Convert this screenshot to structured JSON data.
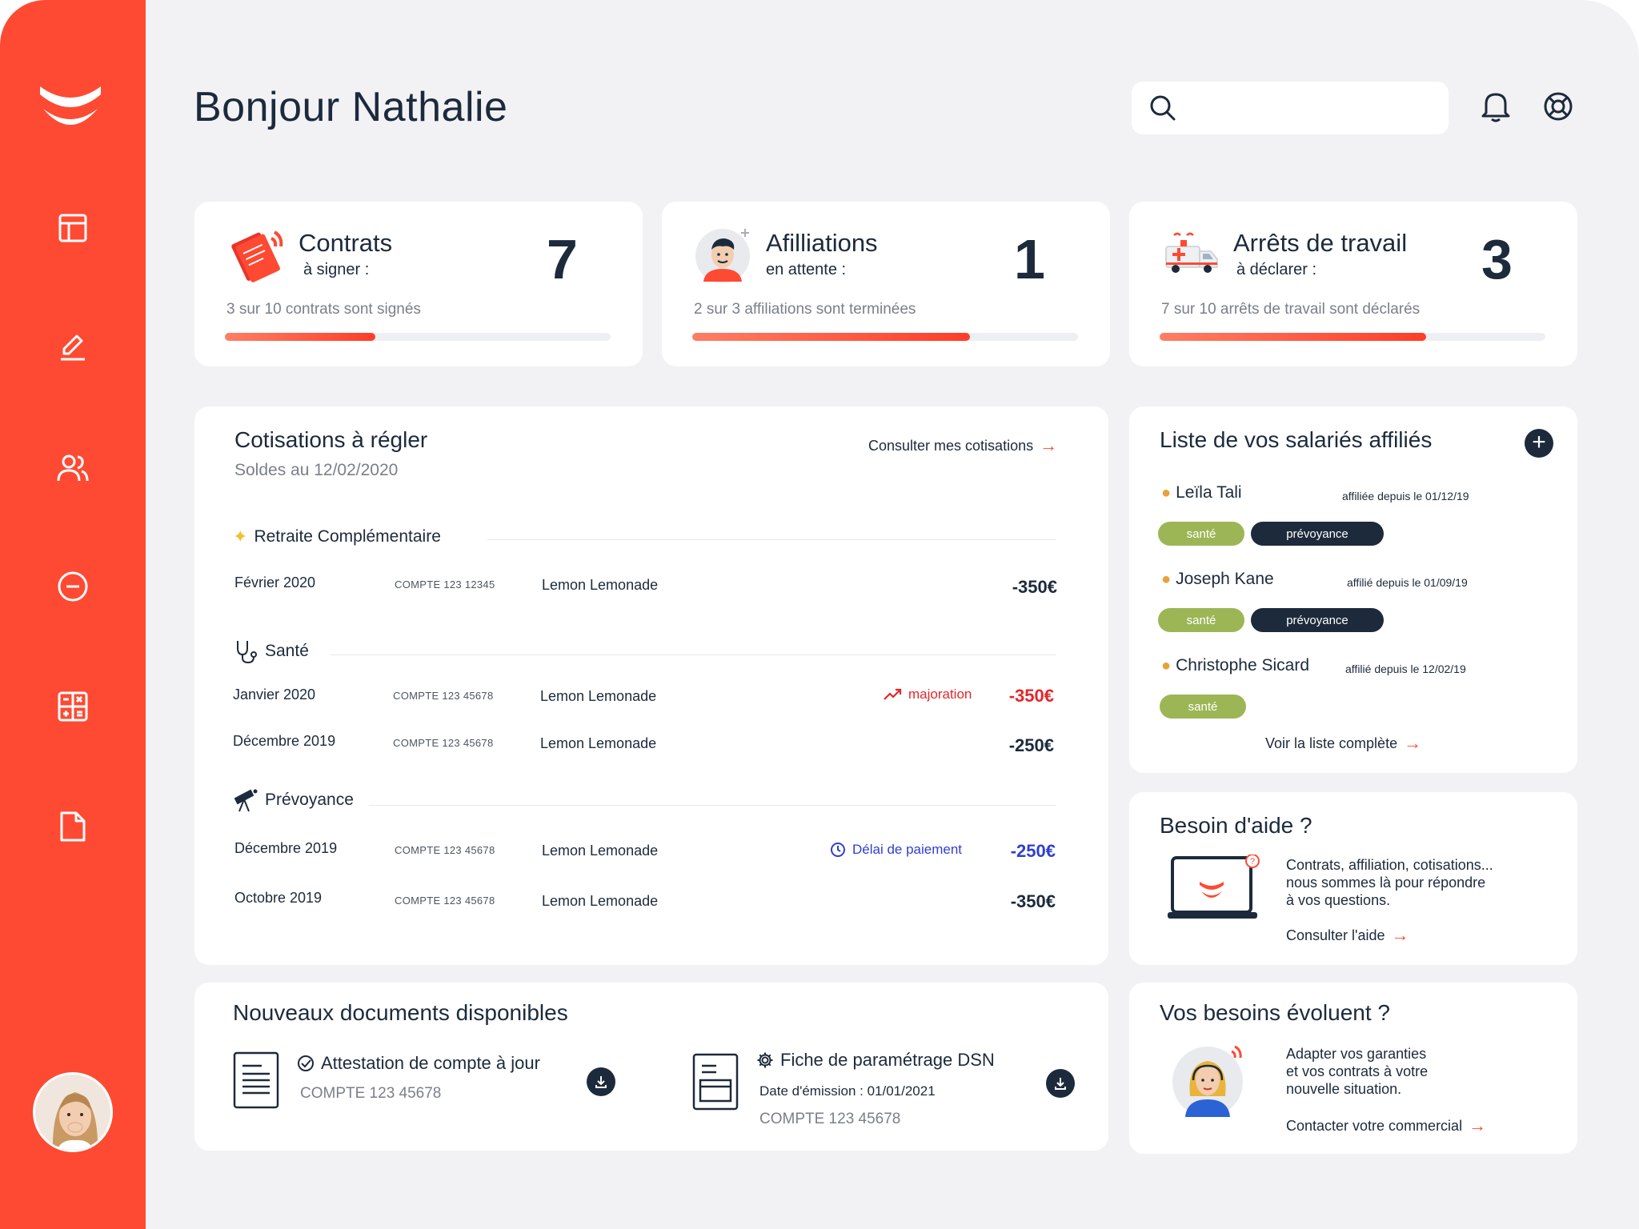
{
  "greeting": "Bonjour Nathalie",
  "search": {
    "placeholder": "",
    "value": ""
  },
  "stats": [
    {
      "title": "Contrats",
      "subtitle": "à signer :",
      "count": "7",
      "description": "3 sur 10 contrats sont signés",
      "progress": 0.39
    },
    {
      "title": "Afilliations",
      "subtitle": "en attente :",
      "count": "1",
      "description": "2 sur 3 affiliations sont terminées",
      "progress": 0.72
    },
    {
      "title": "Arrêts de travail",
      "subtitle": "à déclarer :",
      "count": "3",
      "description": "7 sur 10 arrêts de travail sont déclarés",
      "progress": 0.69
    }
  ],
  "cotisations": {
    "title": "Cotisations à régler",
    "subtitle": "Soldes au 12/02/2020",
    "link": "Consulter mes cotisations",
    "groups": [
      {
        "title": "Retraite Complémentaire",
        "rows": [
          {
            "date": "Février 2020",
            "account": "COMPTE 123 12345",
            "company": "Lemon Lemonade",
            "note": "",
            "amount": "-350€",
            "amount_color": "#1c2a3c"
          }
        ]
      },
      {
        "title": "Santé",
        "rows": [
          {
            "date": "Janvier 2020",
            "account": "COMPTE 123 45678",
            "company": "Lemon Lemonade",
            "note": "majoration",
            "amount": "-350€",
            "amount_color": "#e5262a"
          },
          {
            "date": "Décembre 2019",
            "account": "COMPTE 123 45678",
            "company": "Lemon Lemonade",
            "note": "",
            "amount": "-250€",
            "amount_color": "#1c2a3c"
          }
        ]
      },
      {
        "title": "Prévoyance",
        "rows": [
          {
            "date": "Décembre 2019",
            "account": "COMPTE 123 45678",
            "company": "Lemon Lemonade",
            "note": "Délai de paiement",
            "amount": "-250€",
            "amount_color": "#2f3fd0"
          },
          {
            "date": "Octobre 2019",
            "account": "COMPTE 123 45678",
            "company": "Lemon Lemonade",
            "note": "",
            "amount": "-350€",
            "amount_color": "#1c2a3c"
          }
        ]
      }
    ]
  },
  "salaries": {
    "title": "Liste de vos salariés affiliés",
    "link": "Voir la liste complète",
    "items": [
      {
        "name": "Leïla Tali",
        "since": "affiliée depuis le 01/12/19",
        "tags": [
          "santé",
          "prévoyance"
        ]
      },
      {
        "name": "Joseph Kane",
        "since": "affilié depuis le 01/09/19",
        "tags": [
          "santé",
          "prévoyance"
        ]
      },
      {
        "name": "Christophe Sicard",
        "since": "affilié depuis le 12/02/19",
        "tags": [
          "santé"
        ]
      }
    ]
  },
  "help": {
    "title": "Besoin d'aide ?",
    "text": [
      "Contrats, affiliation, cotisations...",
      "nous sommes là pour répondre",
      "à vos questions."
    ],
    "link": "Consulter l'aide"
  },
  "needs": {
    "title": "Vos besoins évoluent ?",
    "text": [
      "Adapter vos garanties",
      "et vos contrats à votre",
      "nouvelle situation."
    ],
    "link": "Contacter votre commercial"
  },
  "documents": {
    "title": "Nouveaux documents disponibles",
    "items": [
      {
        "title": "Attestation de compte à jour",
        "date": "",
        "account": "COMPTE 123 45678"
      },
      {
        "title": "Fiche de paramétrage DSN",
        "date": "Date d'émission : 01/01/2021",
        "account": "COMPTE 123 45678"
      }
    ]
  },
  "colors": {
    "accent": "#fe4a33",
    "dark": "#1c2a3c",
    "green": "#9cb656",
    "background": "#f2f2f5"
  }
}
